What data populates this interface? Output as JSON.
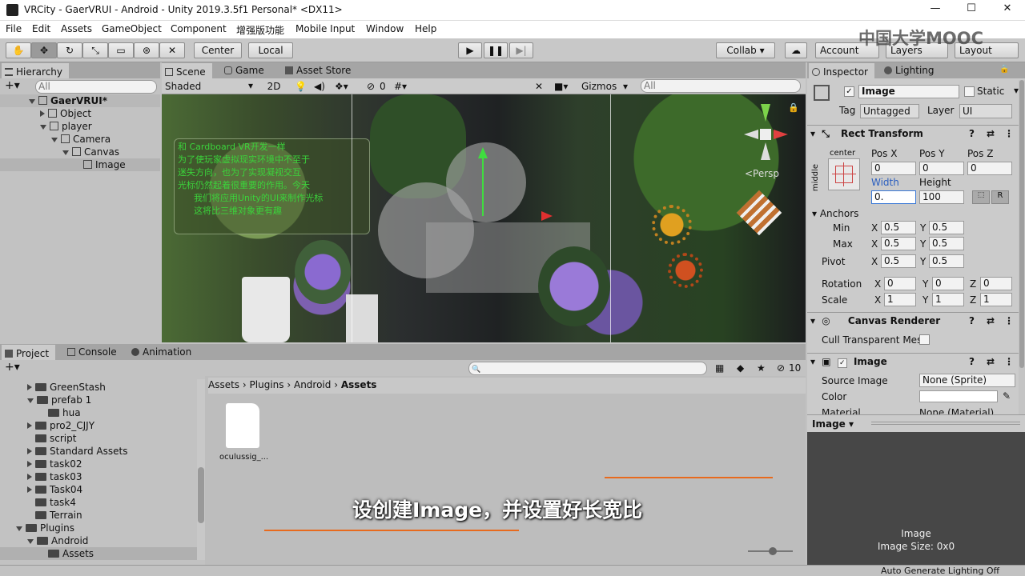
{
  "window": {
    "title": "VRCity - GaerVRUI - Android - Unity 2019.3.5f1 Personal* <DX11>"
  },
  "menu": [
    "File",
    "Edit",
    "Assets",
    "GameObject",
    "Component",
    "增强版功能",
    "Mobile Input",
    "Window",
    "Help"
  ],
  "toolbar": {
    "center": "Center",
    "local": "Local",
    "collab": "Collab ▾",
    "account": "Account",
    "layers": "Layers",
    "layout": "Layout"
  },
  "watermark": "中国大学MOOC",
  "hierarchy": {
    "tab": "Hierarchy",
    "search_placeholder": "All",
    "items": [
      {
        "label": "GaerVRUI*",
        "indent": 0,
        "kind": "scene"
      },
      {
        "label": "Object",
        "indent": 1,
        "kind": "obj"
      },
      {
        "label": "player",
        "indent": 1,
        "kind": "obj"
      },
      {
        "label": "Camera",
        "indent": 2,
        "kind": "obj"
      },
      {
        "label": "Canvas",
        "indent": 3,
        "kind": "obj"
      },
      {
        "label": "Image",
        "indent": 4,
        "kind": "obj"
      }
    ]
  },
  "scene": {
    "tabs": [
      "Scene",
      "Game",
      "Asset Store"
    ],
    "shaded": "Shaded",
    "mode2d": "2D",
    "hidden_count": "0",
    "gizmos": "Gizmos",
    "search_placeholder": "All",
    "persp": "<Persp",
    "overlay_text": [
      "和 Cardboard VR开发一样",
      "为了使玩家虚拟现实环境中不至于",
      "迷失方向，也为了实现凝视交互",
      "光标仍然起着很重要的作用。今天",
      "我们将应用Unity的UI来制作光标",
      "这将比三维对象更有趣"
    ]
  },
  "project": {
    "tabs": [
      "Project",
      "Console",
      "Animation"
    ],
    "tree": [
      {
        "label": "GreenStash",
        "indent": 1,
        "open": false
      },
      {
        "label": "prefab 1",
        "indent": 1,
        "open": true
      },
      {
        "label": "hua",
        "indent": 2,
        "open": null
      },
      {
        "label": "pro2_CJJY",
        "indent": 1,
        "open": false
      },
      {
        "label": "script",
        "indent": 1,
        "open": null
      },
      {
        "label": "Standard Assets",
        "indent": 1,
        "open": false
      },
      {
        "label": "task02",
        "indent": 1,
        "open": false
      },
      {
        "label": "task03",
        "indent": 1,
        "open": false
      },
      {
        "label": "Task04",
        "indent": 1,
        "open": false
      },
      {
        "label": "task4",
        "indent": 1,
        "open": null
      },
      {
        "label": "Terrain",
        "indent": 1,
        "open": null
      },
      {
        "label": "Plugins",
        "indent": 0,
        "open": true
      },
      {
        "label": "Android",
        "indent": 1,
        "open": true
      },
      {
        "label": "Assets",
        "indent": 2,
        "open": null
      }
    ],
    "breadcrumb": [
      "Assets",
      "Plugins",
      "Android",
      "Assets"
    ],
    "file": "oculussig_...",
    "count": "10"
  },
  "inspector": {
    "tabs": [
      "Inspector",
      "Lighting"
    ],
    "name": "Image",
    "static": "Static",
    "tag_label": "Tag",
    "tag": "Untagged",
    "layer_label": "Layer",
    "layer": "UI",
    "rect": {
      "title": "Rect Transform",
      "anchor_h": "center",
      "anchor_v": "middle",
      "pos_labels": [
        "Pos X",
        "Pos Y",
        "Pos Z"
      ],
      "pos": [
        "0",
        "0",
        "0"
      ],
      "width_label": "Width",
      "height_label": "Height",
      "width": "0.",
      "height": "100",
      "r": "R",
      "anchors": "Anchors",
      "min": "Min",
      "max": "Max",
      "pivot": "Pivot",
      "min_x": "0.5",
      "min_y": "0.5",
      "max_x": "0.5",
      "max_y": "0.5",
      "pivot_x": "0.5",
      "pivot_y": "0.5",
      "rotation": "Rotation",
      "scale": "Scale",
      "rot": [
        "0",
        "0",
        "0"
      ],
      "scl": [
        "1",
        "1",
        "1"
      ]
    },
    "canvas_renderer": {
      "title": "Canvas Renderer",
      "cull": "Cull Transparent Mes"
    },
    "image": {
      "title": "Image",
      "source_label": "Source Image",
      "source": "None (Sprite)",
      "color_label": "Color",
      "material_label": "Material",
      "material": "None (Material)"
    },
    "preview": {
      "tab": "Image ▾",
      "name": "Image",
      "size": "Image Size: 0x0"
    }
  },
  "status": "Auto Generate Lighting Off",
  "subtitle": "设创建Image，并设置好长宽比"
}
